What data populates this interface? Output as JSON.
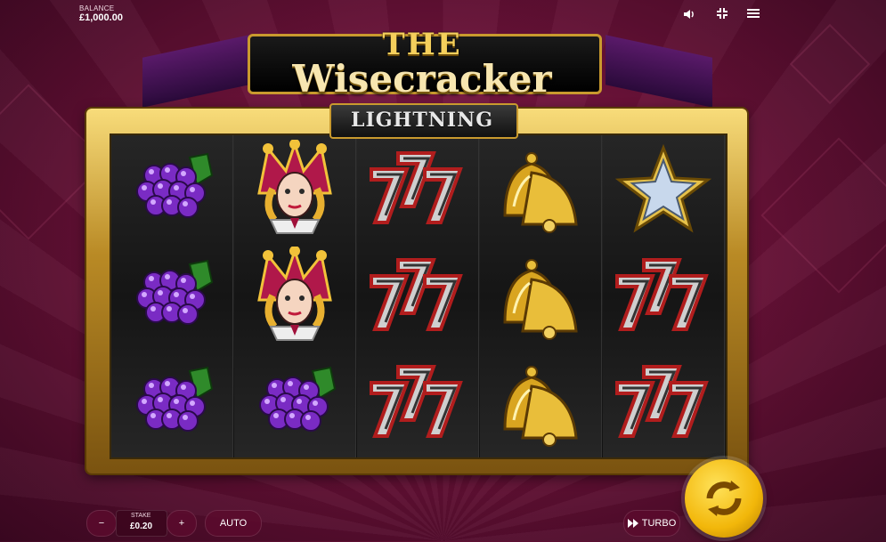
{
  "balance": {
    "label": "BALANCE",
    "value": "£1,000.00"
  },
  "topbar": {
    "sound_icon": "speaker-icon",
    "fullscreen_icon": "fullscreen-icon",
    "menu_icon": "hamburger-menu-icon"
  },
  "title": {
    "the": "THE",
    "main": "Wisecracker",
    "sub": "LIGHTNING"
  },
  "reels": [
    [
      "grapes",
      "grapes",
      "grapes"
    ],
    [
      "jester",
      "jester",
      "grapes"
    ],
    [
      "sevens",
      "sevens",
      "sevens"
    ],
    [
      "bell",
      "bell",
      "bell"
    ],
    [
      "star",
      "sevens",
      "sevens"
    ]
  ],
  "controls": {
    "minus": "−",
    "stake_label": "STAKE",
    "stake_value": "£0.20",
    "plus": "+",
    "auto": "AUTO",
    "turbo_icon": "fast-forward-icon",
    "turbo": "TURBO",
    "spin_icon": "spin-arrows-icon"
  },
  "colors": {
    "background": "#6a1238",
    "gold": "#f2b70a",
    "frame_gold": "#c99a2e"
  }
}
